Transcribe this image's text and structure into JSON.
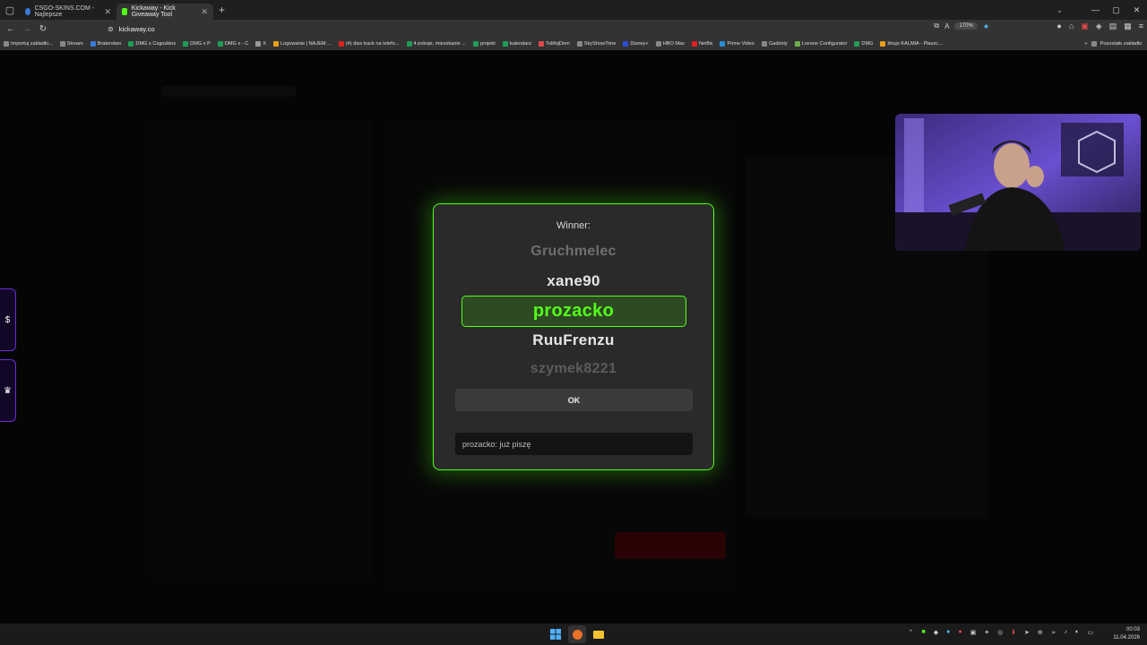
{
  "tabs": [
    {
      "title": "CSGO-SKINS.COM - Najlepsze",
      "active": false,
      "color": "#3a7bd5"
    },
    {
      "title": "Kickaway - Kick Giveaway Tool",
      "active": true,
      "color": "#53ff1a"
    }
  ],
  "address": {
    "url": "kickaway.co",
    "zoom": "170%"
  },
  "bookmarks": [
    {
      "label": "Importuj zakładki...",
      "color": "#888"
    },
    {
      "label": "Stream",
      "color": "#888"
    },
    {
      "label": "Braterstwo",
      "color": "#3a7bd5"
    },
    {
      "label": "DMG x Csgoskins",
      "color": "#1f9d55"
    },
    {
      "label": "DMG x P",
      "color": "#1f9d55"
    },
    {
      "label": "DMG x - C",
      "color": "#1f9d55"
    },
    {
      "label": "X",
      "color": "#999"
    },
    {
      "label": "Logowanie | NAJEM ...",
      "color": "#e8a019"
    },
    {
      "label": "(4) diss track na telefo...",
      "color": "#e02020"
    },
    {
      "label": "4 pokoje, mieszkanie ...",
      "color": "#1f9d55"
    },
    {
      "label": "projekt",
      "color": "#1f9d55"
    },
    {
      "label": "kalendarz",
      "color": "#1f9d55"
    },
    {
      "label": "ToMojDom",
      "color": "#e04a4a"
    },
    {
      "label": "SkyShowTime",
      "color": "#888"
    },
    {
      "label": "Disney+",
      "color": "#2a4bd5"
    },
    {
      "label": "HBO Max",
      "color": "#888"
    },
    {
      "label": "Netflix",
      "color": "#e02020"
    },
    {
      "label": "Prime Video",
      "color": "#2a8bd5"
    },
    {
      "label": "Gadżety",
      "color": "#888"
    },
    {
      "label": "Loxone Configurator",
      "color": "#6ab04c"
    },
    {
      "label": "DMG",
      "color": "#1f9d55"
    },
    {
      "label": "khujo KALMIA - Płaszc...",
      "color": "#e8a019"
    }
  ],
  "bookmarks_other": "Pozostałe zakładki",
  "modal": {
    "label": "Winner:",
    "names": [
      "Gruchmelec",
      "xane90",
      "prozacko",
      "RuuFrenzu",
      "szymek8221"
    ],
    "selected_index": 2,
    "ok_label": "OK",
    "chat_message": "prozacko: już piszę"
  },
  "side_tabs": [
    "$",
    "♛"
  ],
  "colors": {
    "accent": "#53ff1a",
    "brand_purple": "#6a2fd6"
  },
  "clock": {
    "time": "00:03",
    "date": "11.04.2026"
  }
}
